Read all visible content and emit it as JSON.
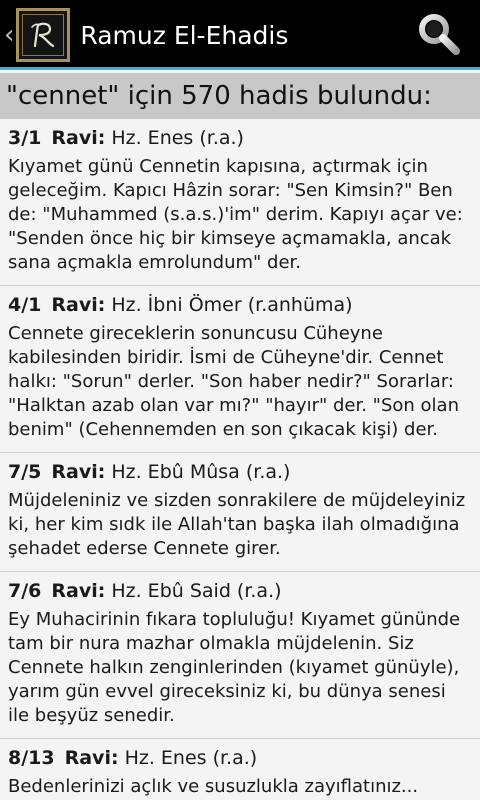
{
  "app": {
    "title": "Ramuz El-Ehadis",
    "logo_letter": "R"
  },
  "search_summary": "\"cennet\" için 570 hadis bulundu:",
  "ravi_label": "Ravi:",
  "results": [
    {
      "ref": "3/1",
      "narrator": "Hz. Enes (r.a.)",
      "text": "Kıyamet günü Cennetin kapısına, açtırmak için geleceğim. Kapıcı Hâzin sorar: \"Sen Kimsin?\" Ben de: \"Muhammed (s.a.s.)'im\" derim. Kapıyı açar ve: \"Senden önce hiç bir kimseye açmamakla, ancak sana açmakla emrolundum\" der."
    },
    {
      "ref": "4/1",
      "narrator": "Hz. İbni Ömer (r.anhüma)",
      "text": "Cennete gireceklerin sonuncusu Cüheyne kabilesinden biridir. İsmi de Cüheyne'dir. Cennet halkı: \"Sorun\" derler. \"Son haber nedir?\" Sorarlar: \"Halktan azab olan var mı?\" \"hayır\" der. \"Son olan benim\" (Cehennemden en son çıkacak kişi) der."
    },
    {
      "ref": "7/5",
      "narrator": "Hz. Ebû Mûsa (r.a.)",
      "text": "Müjdeleniniz ve sizden sonrakilere de müjdeleyiniz ki, her kim sıdk ile Allah'tan başka ilah olmadığına şehadet ederse Cennete girer."
    },
    {
      "ref": "7/6",
      "narrator": "Hz. Ebû Said (r.a.)",
      "text": "Ey Muhacirinin fıkara topluluğu! Kıyamet gününde tam bir nura mazhar olmakla müjdelenin. Siz Cennete halkın zenginlerinden (kıyamet günüyle), yarım gün evvel gireceksiniz ki, bu dünya senesi ile beşyüz senedir."
    },
    {
      "ref": "8/13",
      "narrator": "Hz. Enes (r.a.)",
      "text": "Bedenlerinizi açlık ve susuzlukla zayıflatınız..."
    }
  ]
}
